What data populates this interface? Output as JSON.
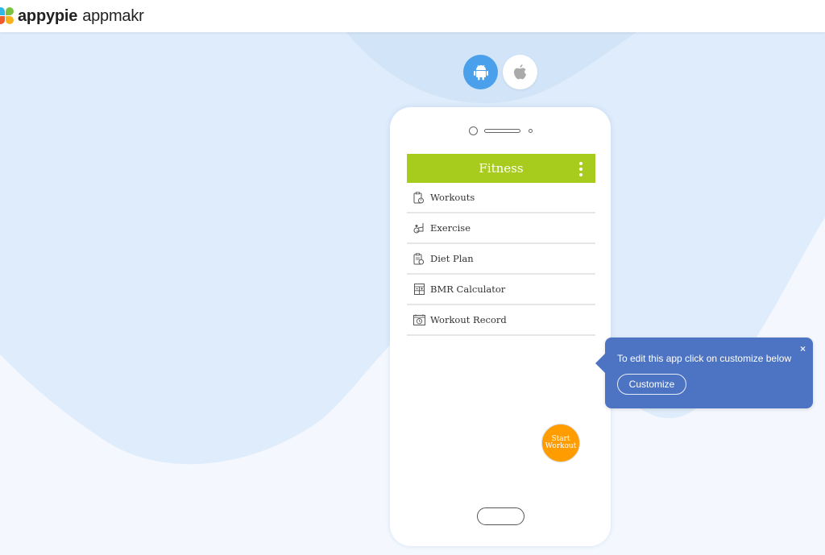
{
  "header": {
    "brand_bold": "appypie",
    "brand_light": "appmakr",
    "logo_icon": "appypie-logo-icon"
  },
  "os_switch": {
    "options": [
      {
        "name": "android",
        "icon": "android-icon",
        "selected": true
      },
      {
        "name": "ios",
        "icon": "apple-icon",
        "selected": false
      }
    ]
  },
  "phone": {
    "app_bar": {
      "title": "Fitness",
      "menu_icon": "kebab-menu-icon"
    },
    "menu_items": [
      {
        "label": "Workouts",
        "icon": "clipboard-timer-icon"
      },
      {
        "label": "Exercise",
        "icon": "exercise-icon"
      },
      {
        "label": "Diet Plan",
        "icon": "diet-plan-icon"
      },
      {
        "label": "BMR Calculator",
        "icon": "calculator-icon"
      },
      {
        "label": "Workout Record",
        "icon": "calendar-clock-icon"
      }
    ],
    "fab": {
      "line1": "Start",
      "line2": "Workout"
    }
  },
  "tooltip": {
    "text": "To edit this app click on customize below",
    "close_label": "×",
    "button_label": "Customize"
  },
  "colors": {
    "app_bar": "#a7cc1d",
    "fab": "#ff9c00",
    "android_selected": "#4aa0ea",
    "tooltip_bg": "#4d74c3",
    "page_bg": "#f4f8fe",
    "blob": "#deecfb"
  }
}
